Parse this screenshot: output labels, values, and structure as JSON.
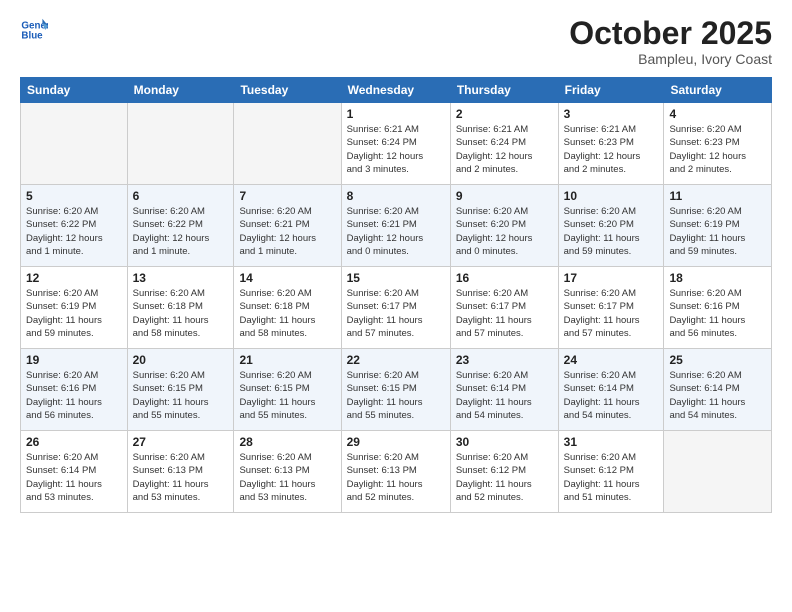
{
  "header": {
    "logo_line1": "General",
    "logo_line2": "Blue",
    "month": "October 2025",
    "location": "Bampleu, Ivory Coast"
  },
  "days_of_week": [
    "Sunday",
    "Monday",
    "Tuesday",
    "Wednesday",
    "Thursday",
    "Friday",
    "Saturday"
  ],
  "weeks": [
    [
      {
        "day": "",
        "info": ""
      },
      {
        "day": "",
        "info": ""
      },
      {
        "day": "",
        "info": ""
      },
      {
        "day": "1",
        "info": "Sunrise: 6:21 AM\nSunset: 6:24 PM\nDaylight: 12 hours\nand 3 minutes."
      },
      {
        "day": "2",
        "info": "Sunrise: 6:21 AM\nSunset: 6:24 PM\nDaylight: 12 hours\nand 2 minutes."
      },
      {
        "day": "3",
        "info": "Sunrise: 6:21 AM\nSunset: 6:23 PM\nDaylight: 12 hours\nand 2 minutes."
      },
      {
        "day": "4",
        "info": "Sunrise: 6:20 AM\nSunset: 6:23 PM\nDaylight: 12 hours\nand 2 minutes."
      }
    ],
    [
      {
        "day": "5",
        "info": "Sunrise: 6:20 AM\nSunset: 6:22 PM\nDaylight: 12 hours\nand 1 minute."
      },
      {
        "day": "6",
        "info": "Sunrise: 6:20 AM\nSunset: 6:22 PM\nDaylight: 12 hours\nand 1 minute."
      },
      {
        "day": "7",
        "info": "Sunrise: 6:20 AM\nSunset: 6:21 PM\nDaylight: 12 hours\nand 1 minute."
      },
      {
        "day": "8",
        "info": "Sunrise: 6:20 AM\nSunset: 6:21 PM\nDaylight: 12 hours\nand 0 minutes."
      },
      {
        "day": "9",
        "info": "Sunrise: 6:20 AM\nSunset: 6:20 PM\nDaylight: 12 hours\nand 0 minutes."
      },
      {
        "day": "10",
        "info": "Sunrise: 6:20 AM\nSunset: 6:20 PM\nDaylight: 11 hours\nand 59 minutes."
      },
      {
        "day": "11",
        "info": "Sunrise: 6:20 AM\nSunset: 6:19 PM\nDaylight: 11 hours\nand 59 minutes."
      }
    ],
    [
      {
        "day": "12",
        "info": "Sunrise: 6:20 AM\nSunset: 6:19 PM\nDaylight: 11 hours\nand 59 minutes."
      },
      {
        "day": "13",
        "info": "Sunrise: 6:20 AM\nSunset: 6:18 PM\nDaylight: 11 hours\nand 58 minutes."
      },
      {
        "day": "14",
        "info": "Sunrise: 6:20 AM\nSunset: 6:18 PM\nDaylight: 11 hours\nand 58 minutes."
      },
      {
        "day": "15",
        "info": "Sunrise: 6:20 AM\nSunset: 6:17 PM\nDaylight: 11 hours\nand 57 minutes."
      },
      {
        "day": "16",
        "info": "Sunrise: 6:20 AM\nSunset: 6:17 PM\nDaylight: 11 hours\nand 57 minutes."
      },
      {
        "day": "17",
        "info": "Sunrise: 6:20 AM\nSunset: 6:17 PM\nDaylight: 11 hours\nand 57 minutes."
      },
      {
        "day": "18",
        "info": "Sunrise: 6:20 AM\nSunset: 6:16 PM\nDaylight: 11 hours\nand 56 minutes."
      }
    ],
    [
      {
        "day": "19",
        "info": "Sunrise: 6:20 AM\nSunset: 6:16 PM\nDaylight: 11 hours\nand 56 minutes."
      },
      {
        "day": "20",
        "info": "Sunrise: 6:20 AM\nSunset: 6:15 PM\nDaylight: 11 hours\nand 55 minutes."
      },
      {
        "day": "21",
        "info": "Sunrise: 6:20 AM\nSunset: 6:15 PM\nDaylight: 11 hours\nand 55 minutes."
      },
      {
        "day": "22",
        "info": "Sunrise: 6:20 AM\nSunset: 6:15 PM\nDaylight: 11 hours\nand 55 minutes."
      },
      {
        "day": "23",
        "info": "Sunrise: 6:20 AM\nSunset: 6:14 PM\nDaylight: 11 hours\nand 54 minutes."
      },
      {
        "day": "24",
        "info": "Sunrise: 6:20 AM\nSunset: 6:14 PM\nDaylight: 11 hours\nand 54 minutes."
      },
      {
        "day": "25",
        "info": "Sunrise: 6:20 AM\nSunset: 6:14 PM\nDaylight: 11 hours\nand 54 minutes."
      }
    ],
    [
      {
        "day": "26",
        "info": "Sunrise: 6:20 AM\nSunset: 6:14 PM\nDaylight: 11 hours\nand 53 minutes."
      },
      {
        "day": "27",
        "info": "Sunrise: 6:20 AM\nSunset: 6:13 PM\nDaylight: 11 hours\nand 53 minutes."
      },
      {
        "day": "28",
        "info": "Sunrise: 6:20 AM\nSunset: 6:13 PM\nDaylight: 11 hours\nand 53 minutes."
      },
      {
        "day": "29",
        "info": "Sunrise: 6:20 AM\nSunset: 6:13 PM\nDaylight: 11 hours\nand 52 minutes."
      },
      {
        "day": "30",
        "info": "Sunrise: 6:20 AM\nSunset: 6:12 PM\nDaylight: 11 hours\nand 52 minutes."
      },
      {
        "day": "31",
        "info": "Sunrise: 6:20 AM\nSunset: 6:12 PM\nDaylight: 11 hours\nand 51 minutes."
      },
      {
        "day": "",
        "info": ""
      }
    ]
  ]
}
